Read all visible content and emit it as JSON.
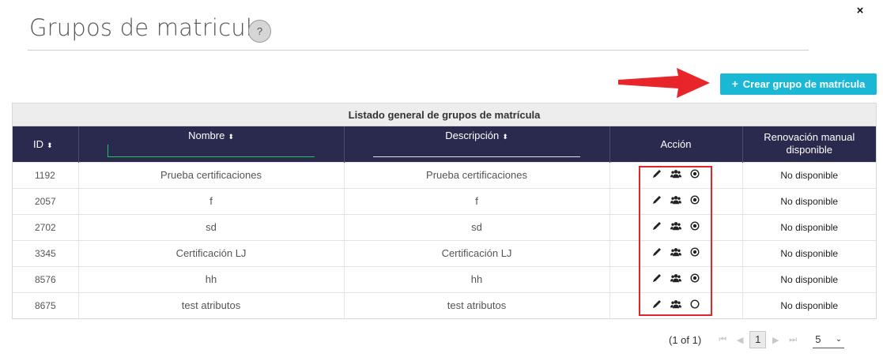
{
  "header": {
    "title": "Grupos de matricula",
    "help_label": "?",
    "close_label": "×"
  },
  "toolbar": {
    "create_label": "Crear grupo de matrícula",
    "create_plus": "+"
  },
  "table": {
    "caption": "Listado general de grupos de matrícula",
    "columns": {
      "id": "ID",
      "nombre": "Nombre",
      "descripcion": "Descripción",
      "accion": "Acción",
      "renovacion": "Renovación manual disponible"
    },
    "sort_glyph": "⬍",
    "rows": [
      {
        "id": "1192",
        "nombre": "Prueba certificaciones",
        "descripcion": "Prueba certificaciones",
        "renovacion": "No disponible",
        "active": true
      },
      {
        "id": "2057",
        "nombre": "f",
        "descripcion": "f",
        "renovacion": "No disponible",
        "active": true
      },
      {
        "id": "2702",
        "nombre": "sd",
        "descripcion": "sd",
        "renovacion": "No disponible",
        "active": true
      },
      {
        "id": "3345",
        "nombre": "Certificación LJ",
        "descripcion": "Certificación LJ",
        "renovacion": "No disponible",
        "active": true
      },
      {
        "id": "8576",
        "nombre": "hh",
        "descripcion": "hh",
        "renovacion": "No disponible",
        "active": true
      },
      {
        "id": "8675",
        "nombre": "test atributos",
        "descripcion": "test atributos",
        "renovacion": "No disponible",
        "active": false
      }
    ]
  },
  "pager": {
    "info": "(1 of 1)",
    "current_page": "1",
    "page_size": "5"
  },
  "colors": {
    "accent": "#1bb8d6",
    "header_bg": "#2a2a4e",
    "highlight": "#e0262a"
  },
  "icons": [
    "edit-icon",
    "users-icon",
    "radio-icon",
    "close-icon",
    "help-icon"
  ]
}
